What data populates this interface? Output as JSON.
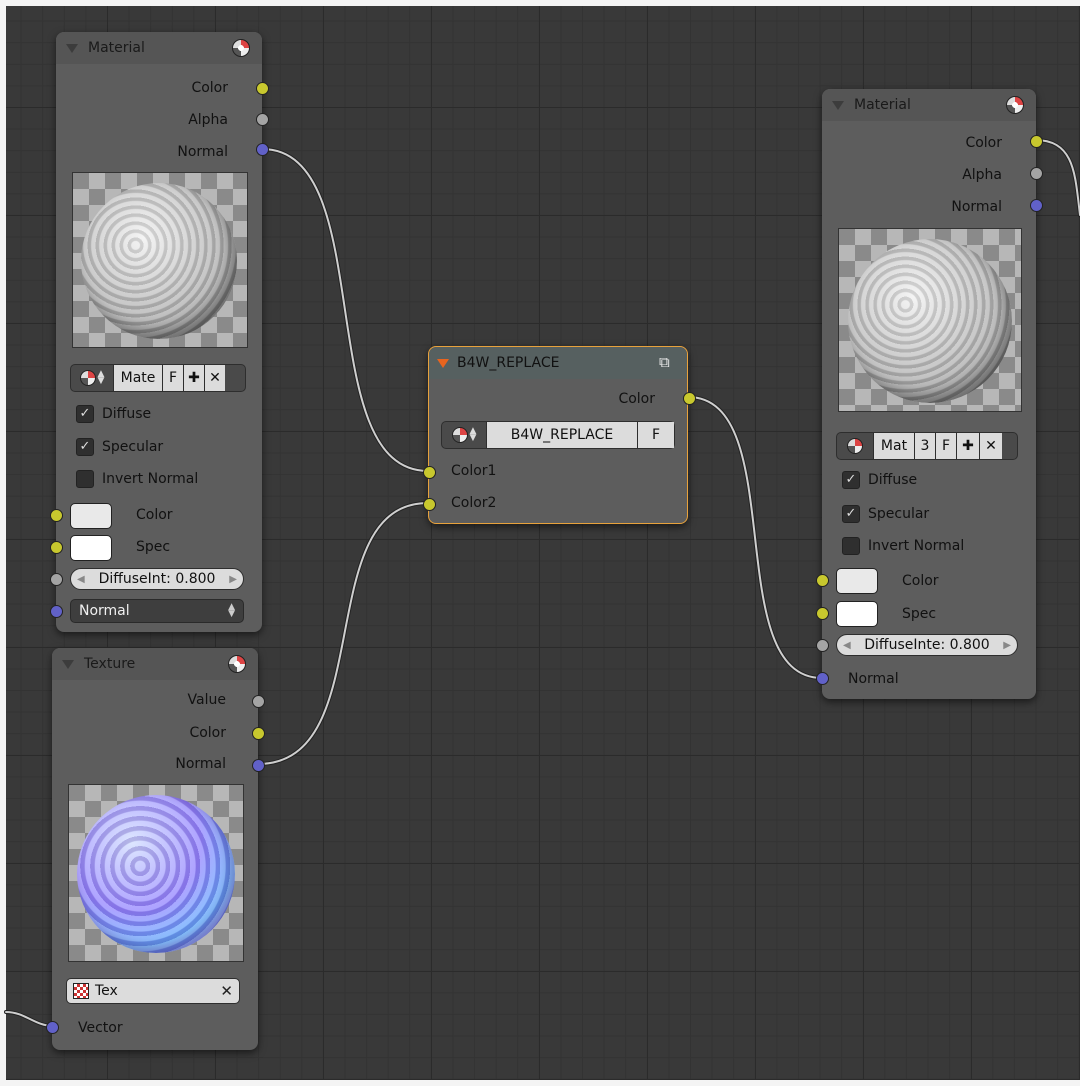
{
  "colors": {
    "socket_color": "#c8c82e",
    "socket_value": "#a4a4a4",
    "socket_vector": "#6161c8",
    "selected_outline": "#e8a23c"
  },
  "material_node_1": {
    "title": "Material",
    "outputs": [
      "Color",
      "Alpha",
      "Normal"
    ],
    "selector": {
      "name": "Mate",
      "fake_user": "F",
      "add_icon": "plus-icon",
      "remove_icon": "x-icon"
    },
    "checkboxes": [
      {
        "label": "Diffuse",
        "checked": true
      },
      {
        "label": "Specular",
        "checked": true
      },
      {
        "label": "Invert Normal",
        "checked": false
      }
    ],
    "inputs": {
      "color_label": "Color",
      "spec_label": "Spec",
      "diffuse_slider": "DiffuseInt: 0.800",
      "normal_dropdown": "Normal"
    }
  },
  "texture_node": {
    "title": "Texture",
    "outputs": [
      "Value",
      "Color",
      "Normal"
    ],
    "texture_field": "Tex",
    "vector_label": "Vector"
  },
  "group_node": {
    "title": "B4W_REPLACE",
    "output": "Color",
    "selector": {
      "name": "B4W_REPLACE",
      "fake_user": "F"
    },
    "inputs": [
      "Color1",
      "Color2"
    ]
  },
  "material_node_2": {
    "title": "Material",
    "outputs": [
      "Color",
      "Alpha",
      "Normal"
    ],
    "selector": {
      "name": "Mat",
      "users": "3",
      "fake_user": "F",
      "add_icon": "plus-icon",
      "remove_icon": "x-icon"
    },
    "checkboxes": [
      {
        "label": "Diffuse",
        "checked": true
      },
      {
        "label": "Specular",
        "checked": true
      },
      {
        "label": "Invert Normal",
        "checked": false
      }
    ],
    "inputs": {
      "color_label": "Color",
      "spec_label": "Spec",
      "diffuse_slider": "DiffuseInte: 0.800",
      "normal_label": "Normal"
    }
  }
}
